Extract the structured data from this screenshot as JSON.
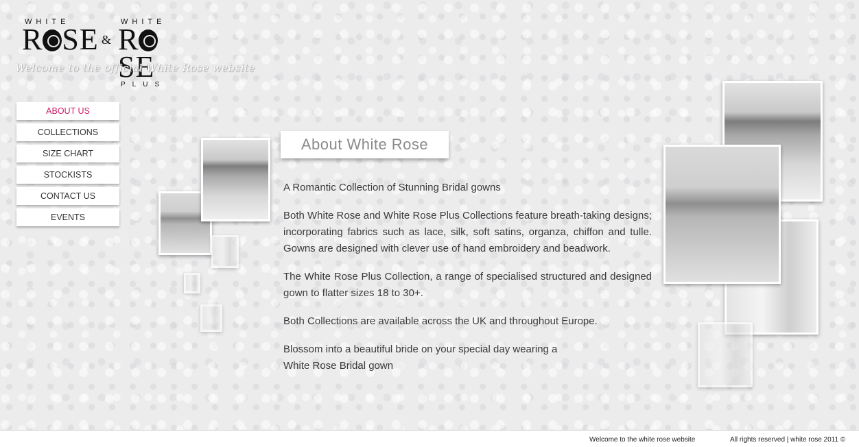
{
  "brand": {
    "logo_small_left": "WHITE",
    "logo_big_left": "R SE",
    "logo_amp": "&",
    "logo_small_right": "WHITE",
    "logo_big_right": "R SE",
    "logo_plus": "PLUS",
    "tagline": "Welcome to the official White Rose website"
  },
  "nav": {
    "items": [
      {
        "label": "ABOUT US",
        "active": true
      },
      {
        "label": "COLLECTIONS",
        "active": false
      },
      {
        "label": "SIZE CHART",
        "active": false
      },
      {
        "label": "STOCKISTS",
        "active": false
      },
      {
        "label": "CONTACT US",
        "active": false
      },
      {
        "label": "EVENTS",
        "active": false
      }
    ]
  },
  "main": {
    "title": "About White Rose",
    "paragraphs": [
      "A Romantic Collection of Stunning Bridal gowns",
      "Both White Rose and White Rose Plus Collections feature breath-taking designs; incorporating fabrics such as lace, silk, soft satins, organza, chiffon and tulle. Gowns are designed with clever use of hand embroidery and beadwork.",
      "The White Rose Plus Collection, a range of specialised structured and designed gown to flatter sizes 18 to 30+.",
      "Both Collections are available across the UK and throughout Europe."
    ],
    "closing_line1": "Blossom into a beautiful bride on your special day wearing a",
    "closing_line2": "White Rose Bridal gown"
  },
  "footer": {
    "left": "Welcome to the white rose website",
    "right": "All rights reserved | white rose 2011 ©"
  },
  "colors": {
    "accent_active": "#cc1f6a",
    "background": "#ececed",
    "title_text": "#8a8a8a"
  }
}
